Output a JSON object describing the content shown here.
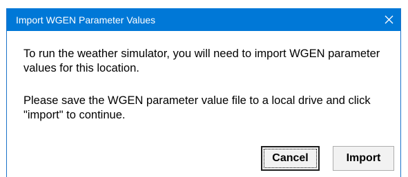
{
  "window": {
    "title": "Import WGEN Parameter Values",
    "close_icon": "close-icon"
  },
  "message": {
    "paragraph_1": "To run the weather simulator, you will need to import WGEN parameter values for this location.",
    "paragraph_2": "Please save the WGEN parameter value file to a local drive and click \"import\" to continue."
  },
  "buttons": {
    "cancel_label": "Cancel",
    "import_label": "Import"
  },
  "colors": {
    "titlebar": "#0078d7",
    "title_text": "#ffffff",
    "background": "#ffffff"
  }
}
